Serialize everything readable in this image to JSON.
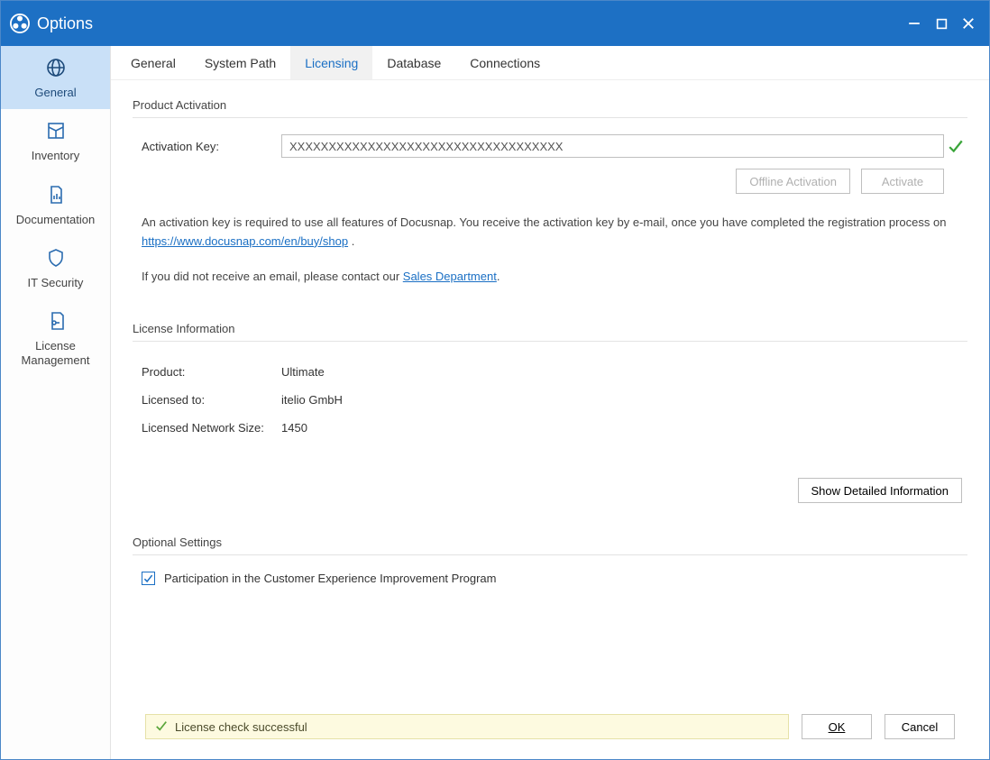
{
  "window": {
    "title": "Options"
  },
  "sidebar": {
    "items": [
      {
        "label": "General",
        "icon": "globe",
        "selected": true
      },
      {
        "label": "Inventory",
        "icon": "box"
      },
      {
        "label": "Documentation",
        "icon": "document-chart"
      },
      {
        "label": "IT Security",
        "icon": "shield"
      },
      {
        "label": "License\nManagement",
        "icon": "key-doc"
      }
    ]
  },
  "tabs": [
    {
      "label": "General"
    },
    {
      "label": "System Path"
    },
    {
      "label": "Licensing",
      "active": true
    },
    {
      "label": "Database"
    },
    {
      "label": "Connections"
    }
  ],
  "activation": {
    "section_title": "Product Activation",
    "key_label": "Activation Key:",
    "key_value": "XXXXXXXXXXXXXXXXXXXXXXXXXXXXXXXXXXX",
    "offline_btn": "Offline Activation",
    "activate_btn": "Activate",
    "desc_pre": "An activation key is required to use all features of Docusnap. You receive the activation key by e-mail, once you have completed the registration process on ",
    "desc_link": "https://www.docusnap.com/en/buy/shop",
    "desc_post": " .",
    "contact_pre": "If you did not receive an email, please contact our ",
    "contact_link": "Sales Department",
    "contact_post": "."
  },
  "license_info": {
    "section_title": "License Information",
    "rows": [
      {
        "label": "Product:",
        "value": "Ultimate"
      },
      {
        "label": "Licensed to:",
        "value": "itelio GmbH"
      },
      {
        "label": "Licensed Network Size:",
        "value": "1450"
      }
    ],
    "detail_btn": "Show Detailed Information"
  },
  "optional": {
    "section_title": "Optional Settings",
    "checkbox_label": "Participation in the Customer Experience Improvement Program",
    "checked": true
  },
  "status": {
    "text": "License check successful"
  },
  "footer": {
    "ok": "OK",
    "cancel": "Cancel"
  }
}
